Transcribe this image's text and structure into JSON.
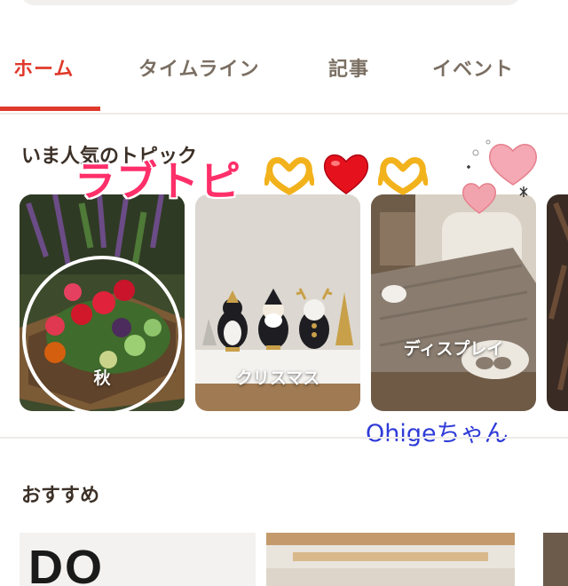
{
  "tabs": [
    {
      "label": "ホーム",
      "active": true
    },
    {
      "label": "タイムライン",
      "active": false
    },
    {
      "label": "記事",
      "active": false
    },
    {
      "label": "イベント",
      "active": false
    }
  ],
  "trending": {
    "title": "いま人気のトピック",
    "topics": [
      {
        "label": "秋"
      },
      {
        "label": "クリスマス"
      },
      {
        "label": "ディスプレイ"
      }
    ]
  },
  "overlay": {
    "title": "ラブトピ",
    "author": "Ohigeちゃん",
    "stickers": [
      "heart-hands-icon",
      "red-heart-icon",
      "heart-hands-icon",
      "pink-hearts-icon"
    ]
  },
  "recommend": {
    "title": "おすすめ",
    "first_card_text": "DO"
  },
  "colors": {
    "accent": "#e03a2c",
    "tab_inactive": "#7b6f63",
    "overlay_pink": "#ff2f6a",
    "signature_blue": "#2f3bd8"
  }
}
